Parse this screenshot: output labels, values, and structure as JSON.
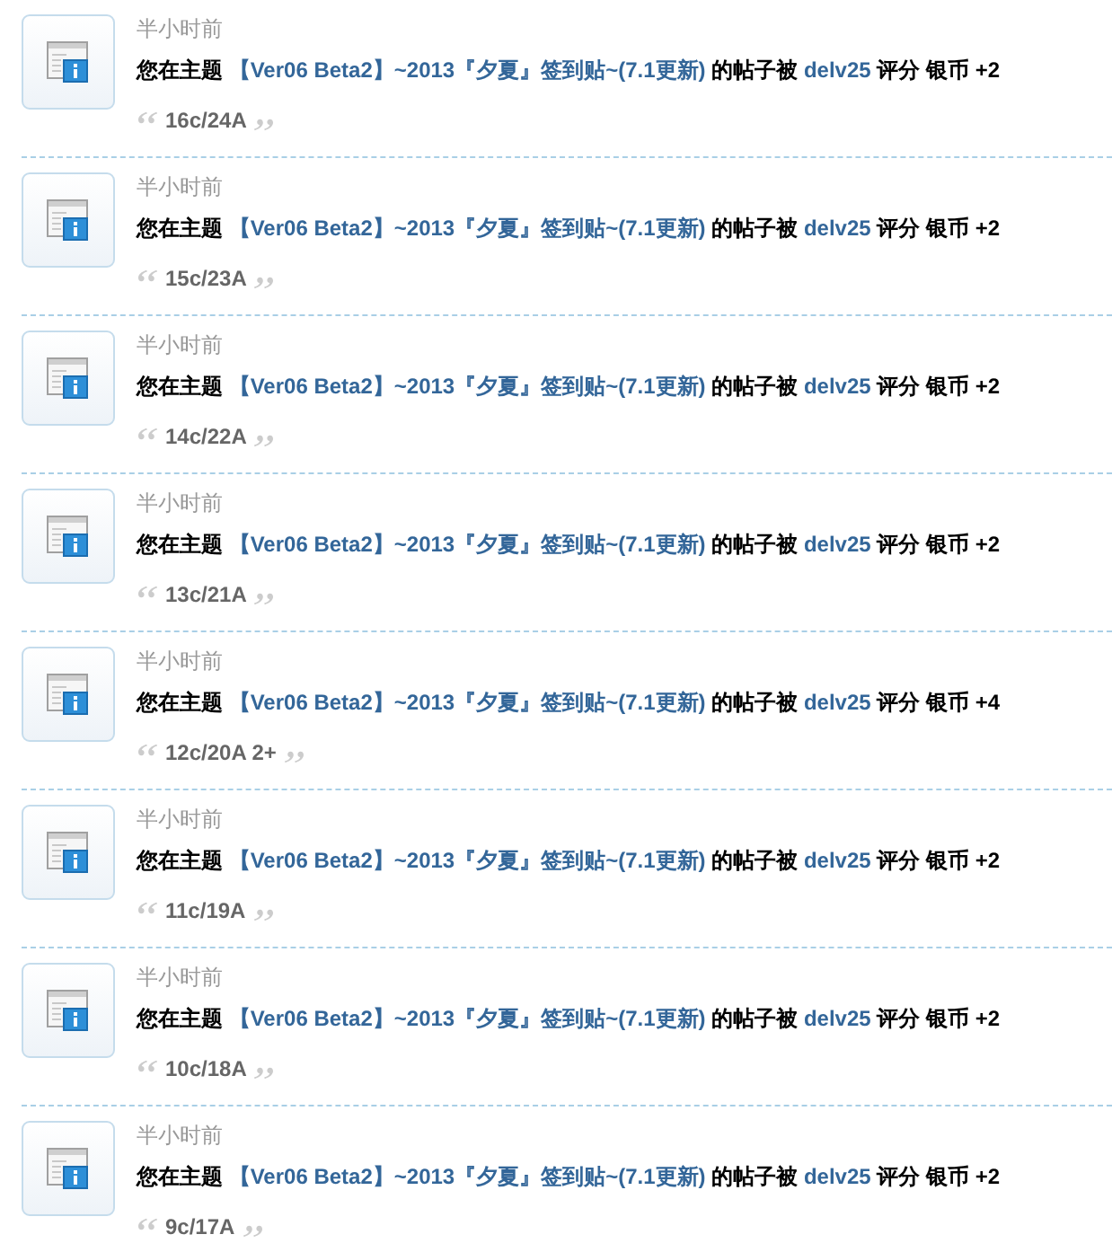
{
  "notices": [
    {
      "time": "半小时前",
      "prefix": "您在主题",
      "thread": "【Ver06 Beta2】~2013『夕夏』签到贴~(7.1更新)",
      "middle": "的帖子被",
      "user": "delv25",
      "suffix": "评分 银币 +2",
      "quote": "16c/24A"
    },
    {
      "time": "半小时前",
      "prefix": "您在主题",
      "thread": "【Ver06 Beta2】~2013『夕夏』签到贴~(7.1更新)",
      "middle": "的帖子被",
      "user": "delv25",
      "suffix": "评分 银币 +2",
      "quote": "15c/23A"
    },
    {
      "time": "半小时前",
      "prefix": "您在主题",
      "thread": "【Ver06 Beta2】~2013『夕夏』签到贴~(7.1更新)",
      "middle": "的帖子被",
      "user": "delv25",
      "suffix": "评分 银币 +2",
      "quote": "14c/22A"
    },
    {
      "time": "半小时前",
      "prefix": "您在主题",
      "thread": "【Ver06 Beta2】~2013『夕夏』签到贴~(7.1更新)",
      "middle": "的帖子被",
      "user": "delv25",
      "suffix": "评分 银币 +2",
      "quote": "13c/21A"
    },
    {
      "time": "半小时前",
      "prefix": "您在主题",
      "thread": "【Ver06 Beta2】~2013『夕夏』签到贴~(7.1更新)",
      "middle": "的帖子被",
      "user": "delv25",
      "suffix": "评分 银币 +4",
      "quote": "12c/20A 2+"
    },
    {
      "time": "半小时前",
      "prefix": "您在主题",
      "thread": "【Ver06 Beta2】~2013『夕夏』签到贴~(7.1更新)",
      "middle": "的帖子被",
      "user": "delv25",
      "suffix": "评分 银币 +2",
      "quote": "11c/19A"
    },
    {
      "time": "半小时前",
      "prefix": "您在主题",
      "thread": "【Ver06 Beta2】~2013『夕夏』签到贴~(7.1更新)",
      "middle": "的帖子被",
      "user": "delv25",
      "suffix": "评分 银币 +2",
      "quote": "10c/18A"
    },
    {
      "time": "半小时前",
      "prefix": "您在主题",
      "thread": "【Ver06 Beta2】~2013『夕夏』签到贴~(7.1更新)",
      "middle": "的帖子被",
      "user": "delv25",
      "suffix": "评分 银币 +2",
      "quote": "9c/17A"
    }
  ]
}
